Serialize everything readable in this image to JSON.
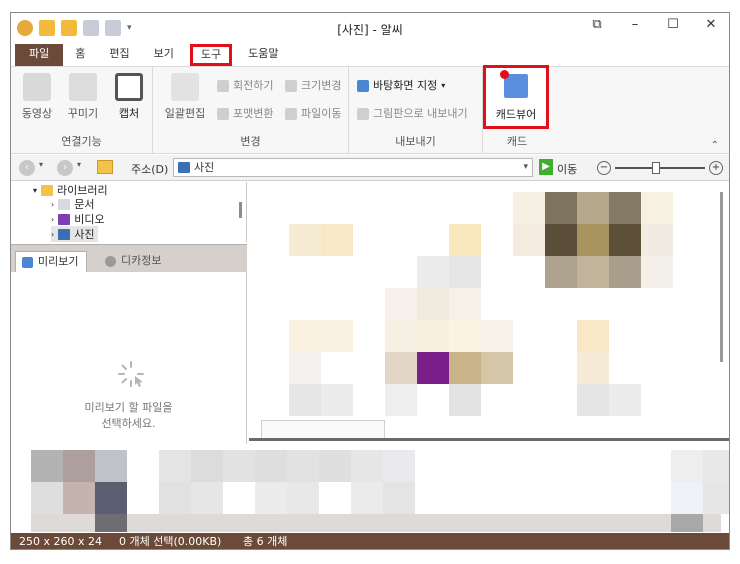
{
  "window": {
    "title": "[사진] - 알씨"
  },
  "tabs": [
    "파일",
    "홈",
    "편집",
    "보기",
    "도구",
    "도움말"
  ],
  "ribbon": {
    "groups": {
      "connect": {
        "label": "연결기능",
        "buttons": [
          "동영상",
          "꾸미기",
          "캡처"
        ]
      },
      "change": {
        "label": "변경",
        "big": "일괄편집",
        "small": [
          "회전하기",
          "크기변경",
          "포맷변환",
          "파일이동"
        ]
      },
      "export": {
        "label": "내보내기",
        "items": [
          "바탕화면 지정",
          "그림판으로 내보내기"
        ]
      },
      "cad": {
        "label": "캐드",
        "button": "캐드뷰어"
      }
    }
  },
  "address": {
    "label": "주소(D)",
    "value": "사진",
    "go_label": "이동"
  },
  "tree": {
    "items": [
      "라이브러리",
      "문서",
      "비디오",
      "사진"
    ]
  },
  "preview": {
    "tabs": [
      "미리보기",
      "디카정보"
    ],
    "message_line1": "미리보기 할 파일을",
    "message_line2": "선택하세요."
  },
  "status": {
    "dimensions": "250 x 260 x 24",
    "selection": "0 개체 선택(0.00KB)",
    "total": "총 6 개체"
  },
  "colors": {
    "brand": "#6b4a3a",
    "highlight": "#e0101a",
    "go_green": "#3fae2f"
  },
  "zoom": {
    "level_fraction": 0.45
  }
}
